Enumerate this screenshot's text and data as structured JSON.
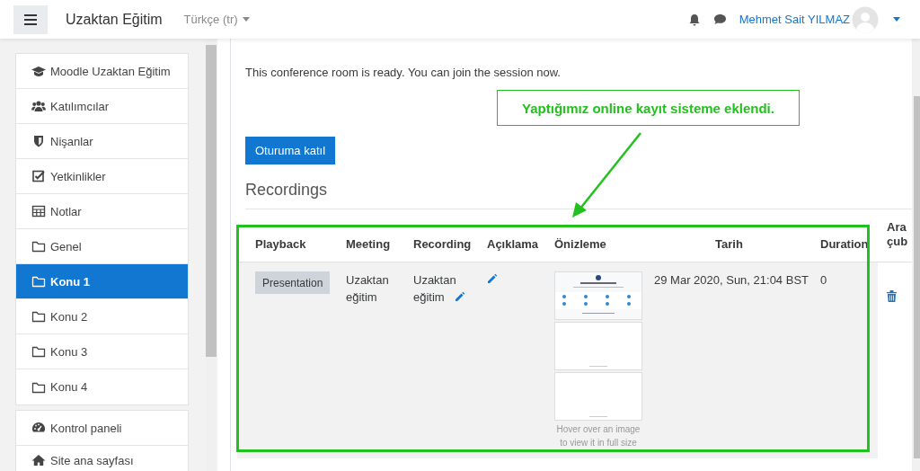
{
  "navbar": {
    "brand": "Uzaktan Eğitim",
    "language": "Türkçe (tr)",
    "user_name": "Mehmet Sait YILMAZ"
  },
  "sidebar": {
    "groups": [
      [
        {
          "label": "Moodle Uzaktan Eğitim",
          "kind": "course",
          "selected": false
        },
        {
          "label": "Katılımcılar",
          "kind": "participants",
          "selected": false
        },
        {
          "label": "Nişanlar",
          "kind": "badges",
          "selected": false
        },
        {
          "label": "Yetkinlikler",
          "kind": "competencies",
          "selected": false
        },
        {
          "label": "Notlar",
          "kind": "grades",
          "selected": false
        },
        {
          "label": "Genel",
          "kind": "section",
          "selected": false
        },
        {
          "label": "Konu 1",
          "kind": "section",
          "selected": true
        },
        {
          "label": "Konu 2",
          "kind": "section",
          "selected": false
        },
        {
          "label": "Konu 3",
          "kind": "section",
          "selected": false
        },
        {
          "label": "Konu 4",
          "kind": "section",
          "selected": false
        }
      ],
      [
        {
          "label": "Kontrol paneli",
          "kind": "dashboard",
          "selected": false
        },
        {
          "label": "Site ana sayfası",
          "kind": "home",
          "selected": false
        }
      ]
    ]
  },
  "main": {
    "status_text": "This conference room is ready. You can join the session now.",
    "join_button": "Oturuma katıl",
    "recordings_heading": "Recordings",
    "table": {
      "columns": [
        "Playback",
        "Meeting",
        "Recording",
        "Açıklama",
        "Önizleme",
        "Tarih",
        "Duration",
        "Ara çub"
      ],
      "rows": [
        {
          "playback": "Presentation",
          "meeting": "Uzaktan eğitim",
          "recording": "Uzaktan eğitim",
          "previews": [
            {
              "kind": "slide"
            },
            {
              "kind": "blank"
            },
            {
              "kind": "blank"
            }
          ],
          "preview_hint": "Hover over an image to view it in full size",
          "date": "29 Mar 2020, Sun, 21:04 BST",
          "duration": "0"
        }
      ]
    }
  },
  "annotation": {
    "text": "Yaptığımız online kayıt sisteme eklendi."
  }
}
